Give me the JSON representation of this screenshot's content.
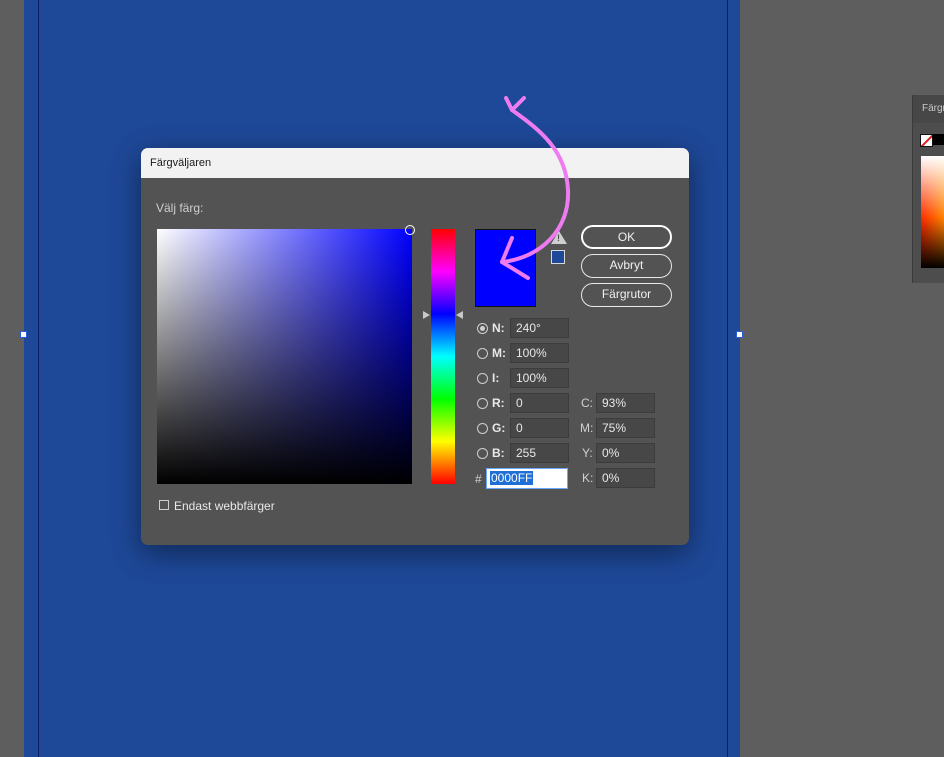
{
  "side_panel": {
    "tab_label": "Färgr"
  },
  "dialog": {
    "title": "Färgväljaren",
    "section_label": "Välj färg:",
    "colors": {
      "selected": "#0000FF",
      "artboard": "#1E4898"
    },
    "buttons": {
      "ok": "OK",
      "cancel": "Avbryt",
      "swatches": "Färgrutor"
    },
    "hsb": {
      "h": {
        "label": "N:",
        "value": "240°"
      },
      "s": {
        "label": "M:",
        "value": "100%"
      },
      "b": {
        "label": "I:",
        "value": "100%"
      }
    },
    "rgb": {
      "r": {
        "label": "R:",
        "value": "0"
      },
      "g": {
        "label": "G:",
        "value": "0"
      },
      "b": {
        "label": "B:",
        "value": "255"
      }
    },
    "hex": {
      "label": "#",
      "value": "0000FF"
    },
    "cmyk": {
      "c": {
        "label": "C:",
        "value": "93%"
      },
      "m": {
        "label": "M:",
        "value": "75%"
      },
      "y": {
        "label": "Y:",
        "value": "0%"
      },
      "k": {
        "label": "K:",
        "value": "0%"
      }
    },
    "web_only_label": "Endast webbfärger",
    "web_only_checked": false,
    "icons": {
      "gamut_warning": "warning-triangle-icon",
      "web_safe": "web-safe-cube-icon"
    }
  }
}
